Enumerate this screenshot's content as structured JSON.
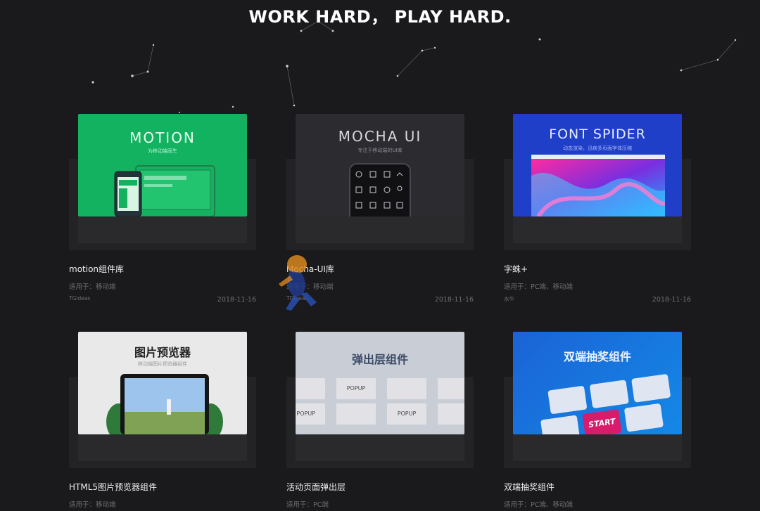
{
  "header": {
    "headline": "WORK HARD， PLAY HARD."
  },
  "cards": [
    {
      "thumb_title": "MOTION",
      "thumb_subtitle": "为移动端而生",
      "title": "motion组件库",
      "applies": "适用于：移动端",
      "author": "TGideas",
      "date": "2018-11-16",
      "thumb_color": "#12b261"
    },
    {
      "thumb_title": "MOCHA UI",
      "thumb_subtitle": "专注于移动端的UI库",
      "title": "Mocha-UI库",
      "applies": "适用于：移动端",
      "author": "TGideas",
      "date": "2018-11-16",
      "thumb_color": "#2b2b30"
    },
    {
      "thumb_title": "FONT SPIDER",
      "thumb_subtitle": "动态渲染，迅疾多页面字体压缩",
      "title": "字蛛+",
      "applies": "适用于：PC端、移动端",
      "author": "水牛",
      "date": "2018-11-16",
      "thumb_color": "#1f3fc9"
    },
    {
      "thumb_title": "图片预览器",
      "thumb_subtitle": "移动端图片预览器组件",
      "title": "HTML5图片预览器组件",
      "applies": "适用于：移动端",
      "thumb_color": "#e9e9e9"
    },
    {
      "thumb_title": "弹出层组件",
      "popup_label": "POPUP",
      "title": "活动页面弹出层",
      "applies": "适用于：PC端",
      "thumb_color": "#c9cdd6"
    },
    {
      "thumb_title": "双端抽奖组件",
      "start_label": "START",
      "title": "双端抽奖组件",
      "applies": "适用于：PC端、移动端",
      "thumb_color": "#1b63d6"
    }
  ]
}
